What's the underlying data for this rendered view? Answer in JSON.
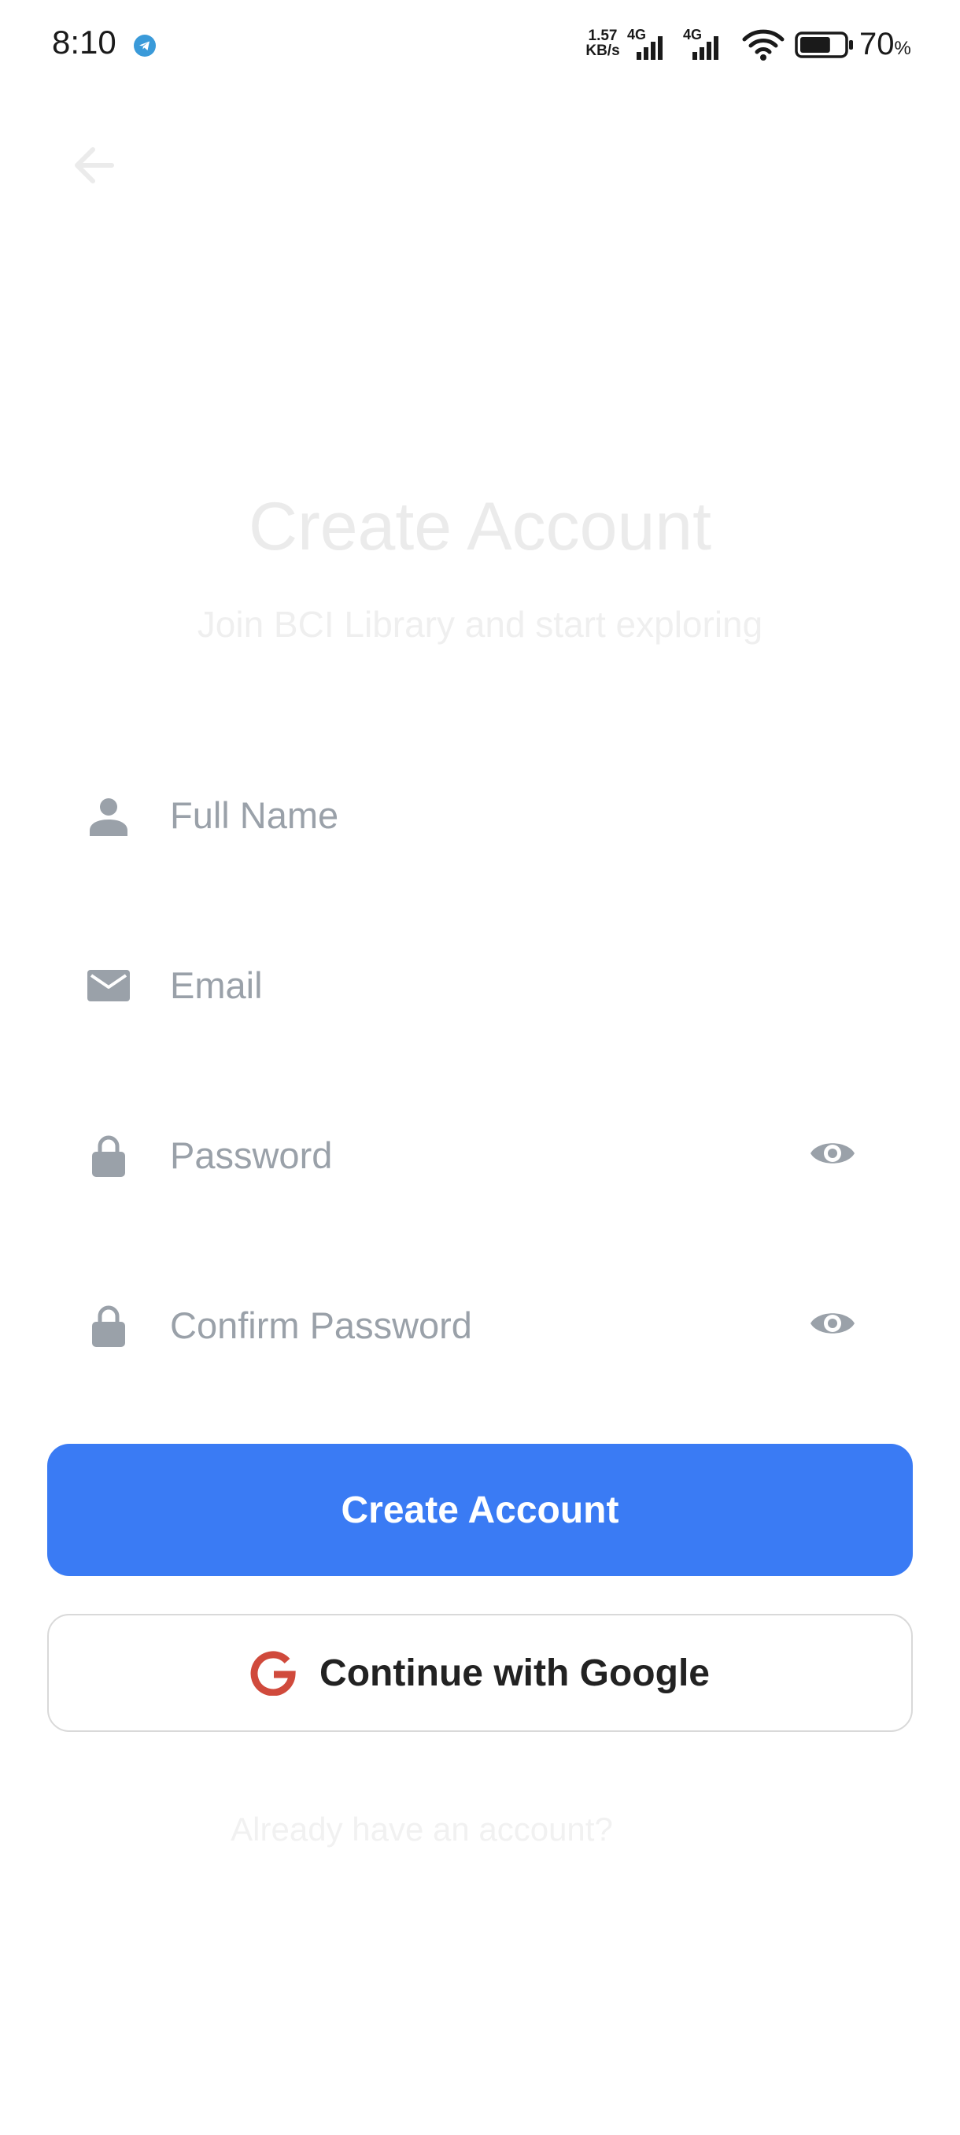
{
  "status_bar": {
    "time": "8:10",
    "net_speed_value": "1.57",
    "net_speed_unit": "KB/s",
    "sim1_label": "4G",
    "sim2_label": "4G",
    "battery_percent": "70",
    "battery_percent_sign": "%",
    "battery_level": 0.7
  },
  "header": {
    "title": "Create Account",
    "subtitle": "Join BCI Library and start exploring"
  },
  "form": {
    "full_name_placeholder": "Full Name",
    "email_placeholder": "Email",
    "password_placeholder": "Password",
    "confirm_password_placeholder": "Confirm Password"
  },
  "actions": {
    "create_account_label": "Create Account",
    "google_label": "Continue with Google",
    "signin_prompt": "Already have an account?"
  },
  "colors": {
    "primary": "#3a7bf4",
    "placeholder": "#9aa1a9",
    "icon": "#9aa1a9",
    "google_red": "#d04a3c"
  },
  "icons": {
    "back": "back-arrow-icon",
    "name": "person-icon",
    "email": "mail-icon",
    "password": "lock-icon",
    "show_password": "eye-icon",
    "google": "google-g-icon"
  }
}
